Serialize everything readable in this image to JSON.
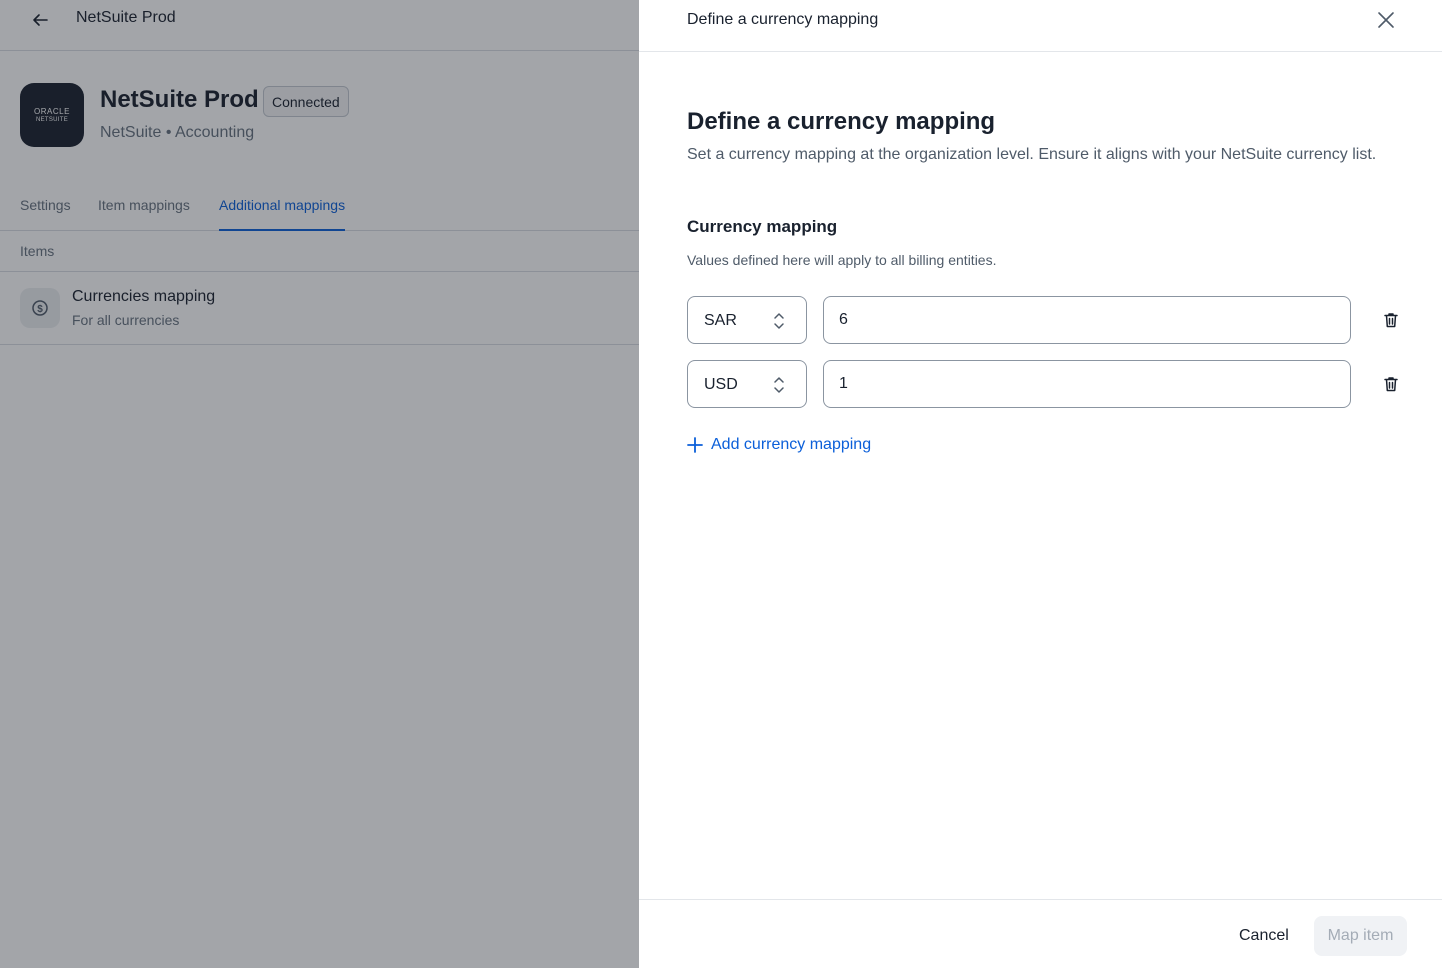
{
  "topbar": {
    "title": "NetSuite Prod",
    "back_icon": "arrow-left-icon"
  },
  "integration": {
    "logo_line1": "ORACLE",
    "logo_line2": "NETSUITE",
    "name": "NetSuite Prod",
    "status": "Connected",
    "subtitle": "NetSuite • Accounting"
  },
  "tabs": [
    {
      "label": "Settings",
      "active": false
    },
    {
      "label": "Item mappings",
      "active": false
    },
    {
      "label": "Additional mappings",
      "active": true
    }
  ],
  "items_section": {
    "label": "Items",
    "rows": [
      {
        "title": "Currencies mapping",
        "subtitle": "For all currencies",
        "icon": "currency-icon"
      }
    ]
  },
  "drawer": {
    "header_title": "Define a currency mapping",
    "title": "Define a currency mapping",
    "description": "Set a currency mapping at the organization level. Ensure it aligns with your NetSuite currency list.",
    "mapping_heading": "Currency mapping",
    "mapping_description": "Values defined here will apply to all billing entities.",
    "mappings": [
      {
        "currency": "SAR",
        "value": "6"
      },
      {
        "currency": "USD",
        "value": "1"
      }
    ],
    "add_label": "Add currency mapping",
    "cancel_label": "Cancel",
    "submit_label": "Map item"
  },
  "colors": {
    "accent": "#0b5fd9",
    "text": "#19212e",
    "muted": "#66727f",
    "overlay": "rgba(25, 30, 40, 0.40)",
    "disabled_button_bg": "#f0f2f5"
  }
}
